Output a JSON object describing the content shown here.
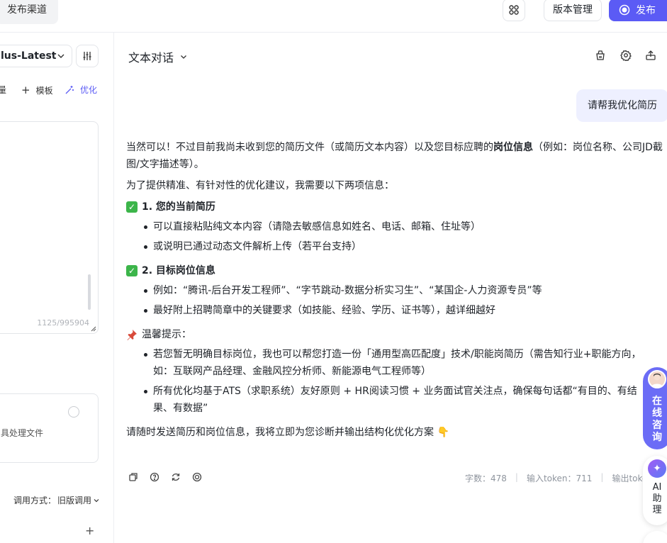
{
  "topbar": {
    "publish_channel_tab": "发布渠道",
    "version_button": "版本管理",
    "publish_button": "发布"
  },
  "left_panel": {
    "model_name": "lus-Latest",
    "tool_partial": "量",
    "template_label": "模板",
    "optimize_label": "优化",
    "char_counter": "1125/995904",
    "upload_hint": "具处理文件",
    "call_mode_label": "调用方式：",
    "call_mode_value": "旧版调用"
  },
  "chat": {
    "title": "文本对话",
    "user_message": "请帮我优化简历",
    "answer": {
      "intro_pre": "当然可以！不过目前我尚未收到您的简历文件（或简历文本内容）以及您目标应聘的",
      "intro_bold": "岗位信息",
      "intro_post": "（例如：岗位名称、公司JD截图/文字描述等）。",
      "need_line": "为了提供精准、有针对性的优化建议，我需要以下两项信息：",
      "section1_title": "1. 您的当前简历",
      "section1_items": [
        "可以直接粘贴纯文本内容（请隐去敏感信息如姓名、电话、邮箱、住址等）",
        "或说明已通过动态文件解析上传（若平台支持）"
      ],
      "section2_title": "2. 目标岗位信息",
      "section2_items": [
        "例如：“腾讯-后台开发工程师”、“字节跳动-数据分析实习生”、“某国企-人力资源专员”等",
        "最好附上招聘简章中的关键要求（如技能、经验、学历、证书等），越详细越好"
      ],
      "tips_title": "温馨提示：",
      "tips_items": [
        "若您暂无明确目标岗位，我也可以帮您打造一份「通用型高匹配度」技术/职能岗简历（需告知行业+职能方向，如：互联网产品经理、金融风控分析师、新能源电气工程师等）",
        "所有优化均基于ATS（求职系统）友好原则 + HR阅读习惯 + 业务面试官关注点，确保每句话都“有目的、有结果、有数据”"
      ],
      "closing": "请随时发送简历和岗位信息，我将立即为您诊断并输出结构化优化方案"
    },
    "stats": {
      "word_count": "字数：478",
      "input_tokens": "输入token：711",
      "output_tokens": "输出token"
    }
  },
  "float": {
    "consult_chars": [
      "在",
      "线",
      "咨",
      "询"
    ],
    "ai_chars": [
      "AI",
      "助",
      "理"
    ]
  },
  "colors": {
    "accent": "#5b5bf5",
    "user_bubble": "#eef0ff",
    "check_green": "#3cb54a"
  }
}
